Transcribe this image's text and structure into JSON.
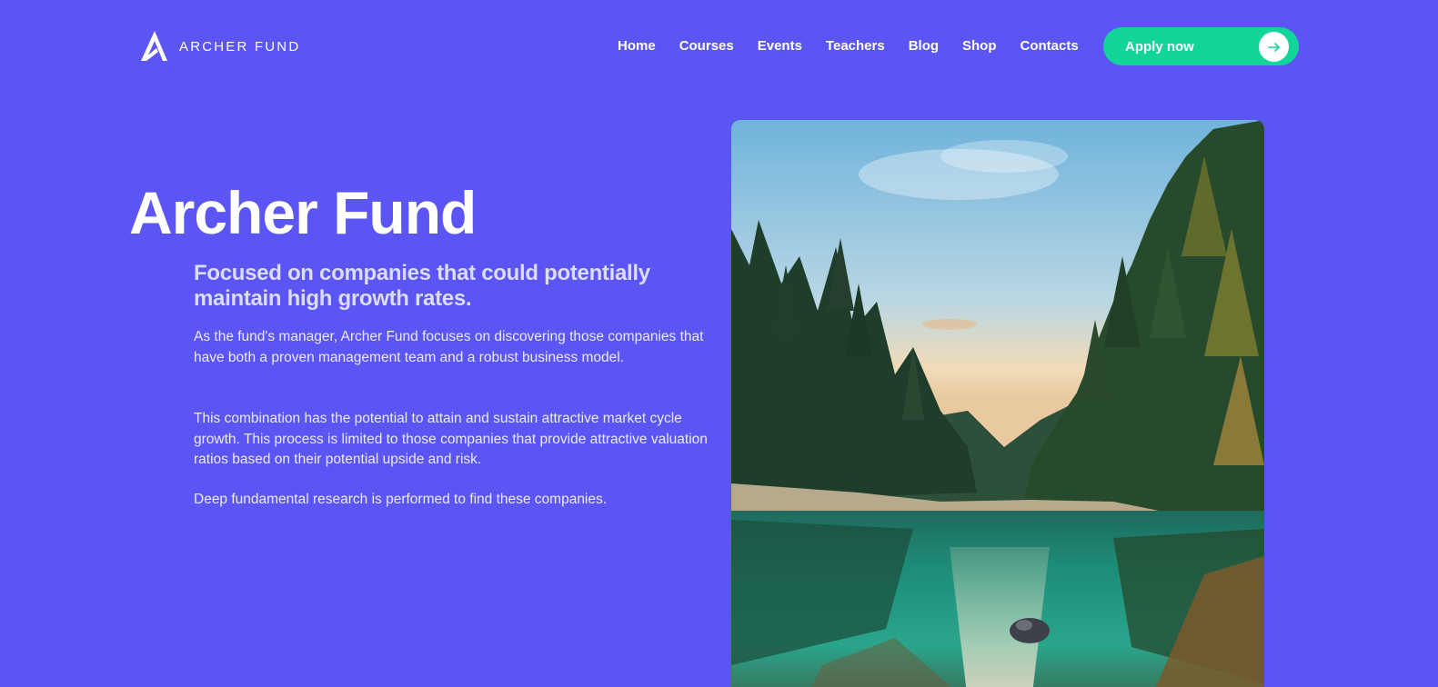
{
  "header": {
    "logo_text": "ARCHER FUND",
    "logo_icon": "archer-a-logo-icon",
    "nav": [
      "Home",
      "Courses",
      "Events",
      "Teachers",
      "Blog",
      "Shop",
      "Contacts"
    ],
    "apply_label": "Apply now",
    "apply_icon": "arrow-right-icon"
  },
  "hero": {
    "title": "Archer Fund",
    "subtitle": "Focused on companies that could potentially maintain high growth rates.",
    "paragraphs": [
      "As the fund's manager, Archer Fund focuses on discovering those companies that have both a proven management team and a robust business model.",
      "This combination has the potential to attain and sustain attractive market cycle growth. This process is limited to those companies that provide attractive valuation ratios based on their potential upside and risk.",
      "Deep fundamental research is performed to find these companies."
    ]
  },
  "colors": {
    "background": "#5b55f4",
    "accent": "#12d59a",
    "text": "#ffffff"
  }
}
